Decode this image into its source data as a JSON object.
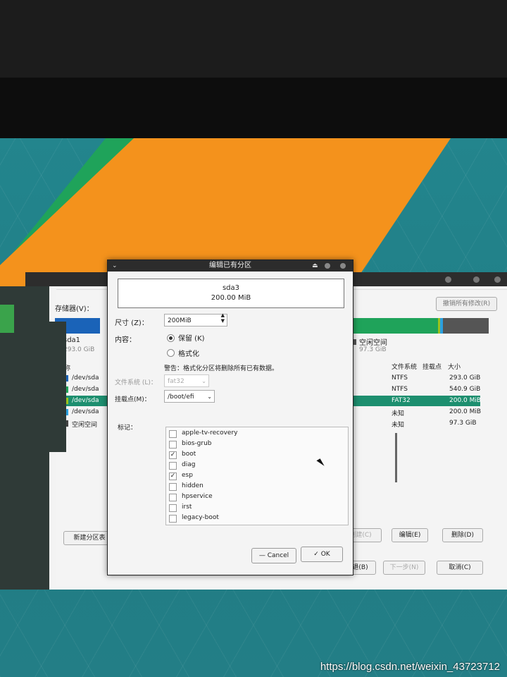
{
  "installer": {
    "storage_label": "存储器(V)：",
    "revert_button": "撤销所有修改(R)",
    "legend": [
      {
        "name": "sda1",
        "size": "293.0 GiB",
        "color": "#1a63b8"
      },
      {
        "name": "空闲空间",
        "size": "97.3 GiB",
        "color": "#555555"
      }
    ],
    "table": {
      "headers": {
        "name": "名称",
        "fs": "文件系统",
        "flags": "挂载点",
        "size": "大小"
      },
      "rows": [
        {
          "name": "/dev/sda",
          "fs": "NTFS",
          "size": "293.0 GiB",
          "color": "#1a63b8",
          "selected": false
        },
        {
          "name": "/dev/sda",
          "fs": "NTFS",
          "size": "540.9 GiB",
          "color": "#1fa35a",
          "selected": false
        },
        {
          "name": "/dev/sda",
          "fs": "FAT32",
          "size": "200.0 MiB",
          "color": "#9bc21d",
          "selected": true
        },
        {
          "name": "/dev/sda",
          "fs": "未知",
          "size": "200.0 MiB",
          "color": "#2aa0e0",
          "selected": false
        },
        {
          "name": "空闲空间",
          "fs": "未知",
          "size": "97.3 GiB",
          "color": "#444444",
          "selected": false
        }
      ]
    },
    "buttons": {
      "new_table": "新建分区表",
      "create": "创建(C)",
      "edit": "编辑(E)",
      "delete": "删除(D)",
      "back": "后退(B)",
      "next": "下一步(N)",
      "cancel": "取消(C)"
    }
  },
  "dialog": {
    "title": "编辑已有分区",
    "partition_name": "sda3",
    "partition_size": "200.00 MiB",
    "size_label": "尺寸 (Z)：",
    "size_value": "200MiB",
    "content_label": "内容：",
    "keep_label": "保留 (K)",
    "format_label": "格式化",
    "warning": "警告：格式化分区将删除所有已有数据。",
    "fs_label": "文件系统 (L)：",
    "fs_value": "fat32",
    "mount_label": "挂载点(M)：",
    "mount_value": "/boot/efi",
    "flags_label": "标记：",
    "flags": [
      {
        "name": "apple-tv-recovery",
        "checked": false
      },
      {
        "name": "bios-grub",
        "checked": false
      },
      {
        "name": "boot",
        "checked": true
      },
      {
        "name": "diag",
        "checked": false
      },
      {
        "name": "esp",
        "checked": true
      },
      {
        "name": "hidden",
        "checked": false
      },
      {
        "name": "hpservice",
        "checked": false
      },
      {
        "name": "irst",
        "checked": false
      },
      {
        "name": "legacy-boot",
        "checked": false
      }
    ],
    "cancel_button": "Cancel",
    "ok_button": "OK"
  },
  "watermark": "https://blog.csdn.net/weixin_43723712",
  "colors": {
    "selection": "#1d8f6f",
    "bar_blue": "#1a63b8",
    "bar_green": "#1fa35a",
    "free_space": "#555555"
  }
}
